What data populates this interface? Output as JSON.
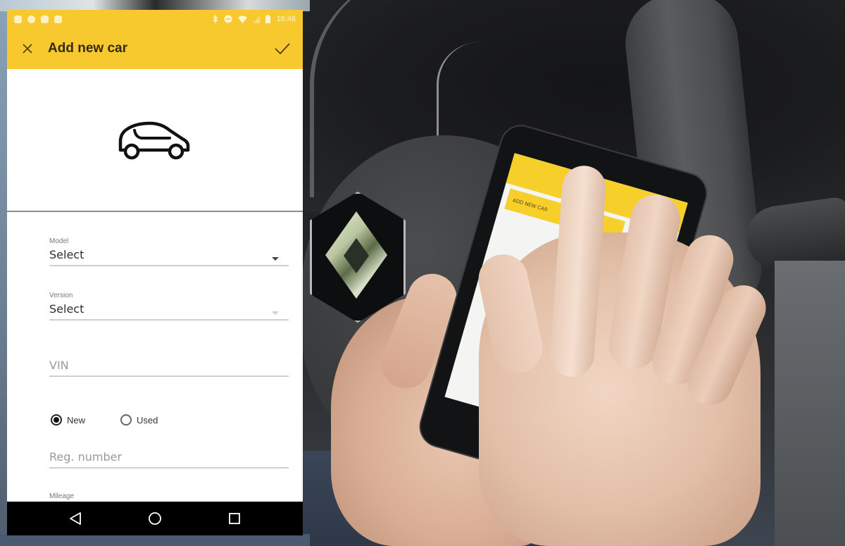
{
  "status_bar": {
    "time": "16:46",
    "left_icons": [
      "image-notification-icon",
      "notification-icon",
      "camera-notification-icon",
      "notification-icon"
    ],
    "right_icons": [
      "bluetooth-icon",
      "do-not-disturb-icon",
      "wifi-icon",
      "signal-icon",
      "battery-icon"
    ]
  },
  "toolbar": {
    "title": "Add new car",
    "close_icon": "close-icon",
    "confirm_icon": "check-icon",
    "background_color": "#f8c92f"
  },
  "hero": {
    "icon": "car-icon"
  },
  "form": {
    "model": {
      "label": "Model",
      "value": "Select"
    },
    "version": {
      "label": "Version",
      "value": "Select"
    },
    "vin": {
      "placeholder": "VIN"
    },
    "condition": {
      "options": [
        {
          "label": "New",
          "selected": true
        },
        {
          "label": "Used",
          "selected": false
        }
      ]
    },
    "reg_number": {
      "placeholder": "Reg. number"
    },
    "mileage": {
      "label": "Mileage"
    }
  },
  "nav_bar": {
    "back": "back-icon",
    "home": "home-icon",
    "recents": "recents-icon"
  },
  "background_scene": {
    "held_phone_button": "ADD NEW CAR"
  }
}
